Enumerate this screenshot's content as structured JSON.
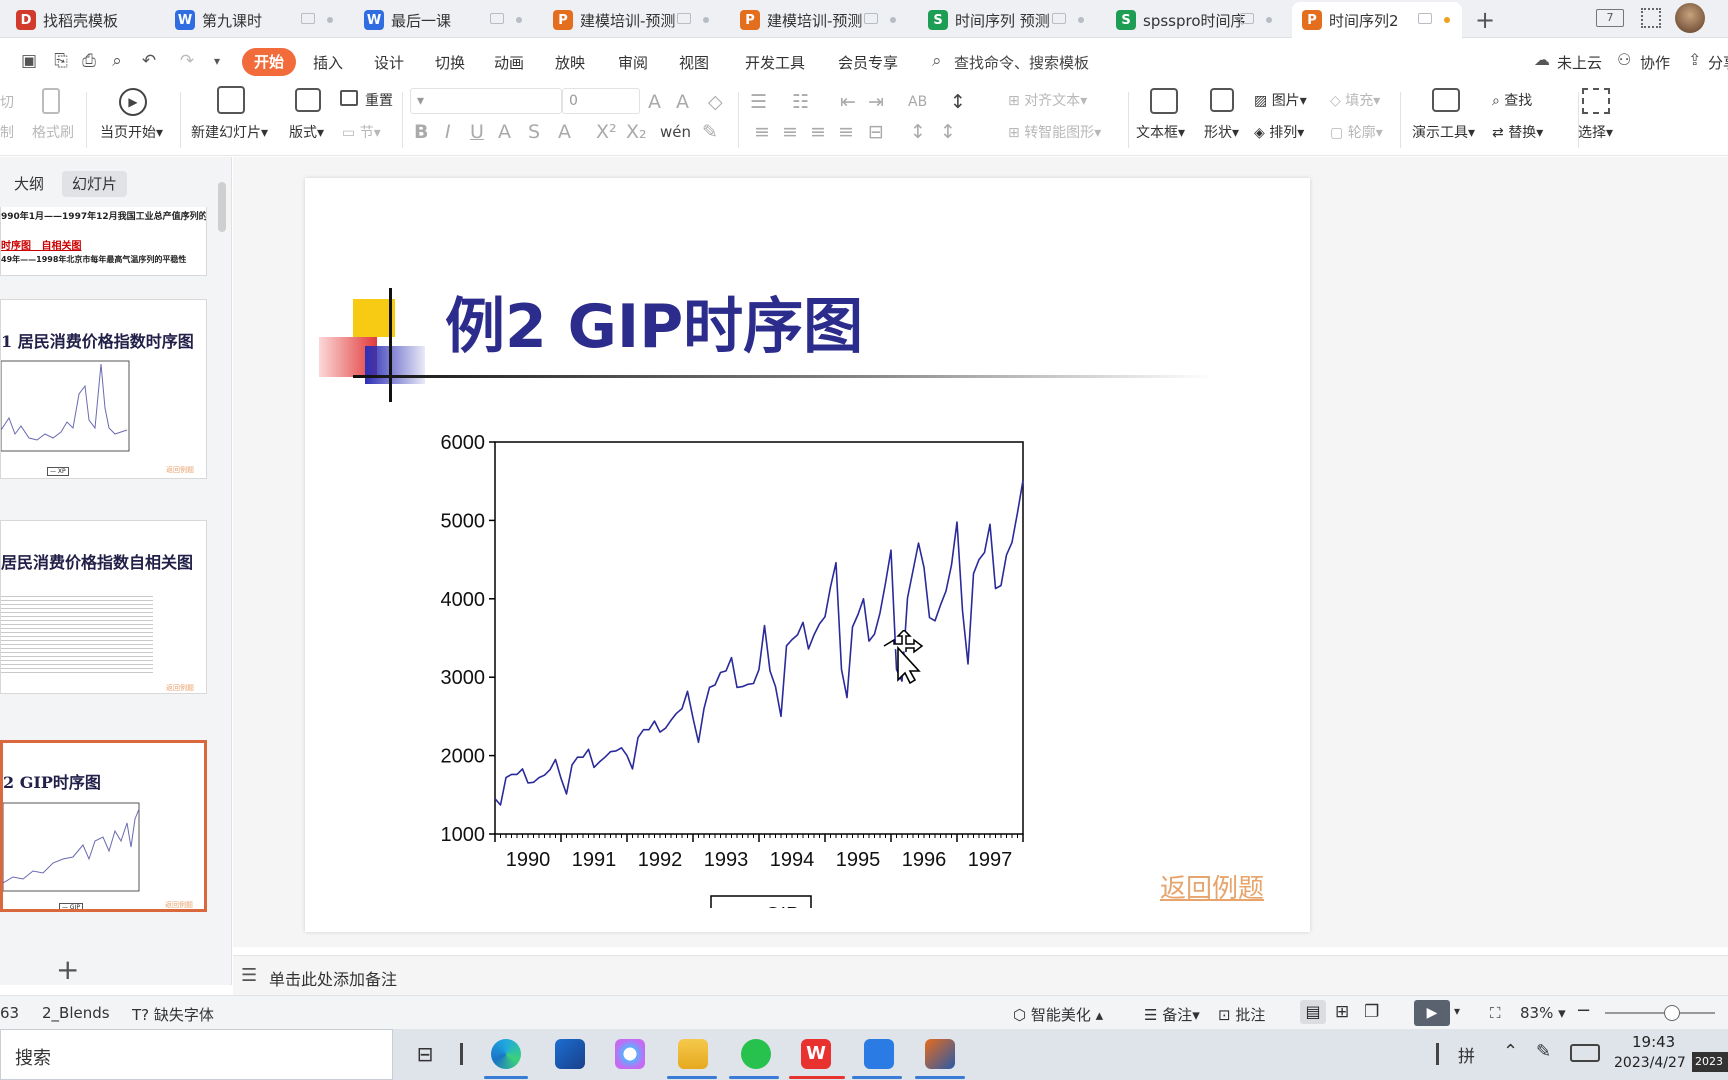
{
  "tabs": [
    {
      "label": "找稻壳模板",
      "icon": "docer-icon",
      "color": "#d23b2c",
      "glyph": "D",
      "active": false
    },
    {
      "label": "第九课时",
      "icon": "writer-doc-icon",
      "color": "#2f6de1",
      "glyph": "W",
      "active": false
    },
    {
      "label": "最后一课",
      "icon": "writer-doc-icon",
      "color": "#2f6de1",
      "glyph": "W",
      "active": false
    },
    {
      "label": "建模培训-预测",
      "icon": "presentation-icon",
      "color": "#e36f1e",
      "glyph": "P",
      "active": false
    },
    {
      "label": "建模培训-预测",
      "icon": "presentation-icon",
      "color": "#e36f1e",
      "glyph": "P",
      "active": false
    },
    {
      "label": "时间序列 预测",
      "icon": "spreadsheet-icon",
      "color": "#1e9e55",
      "glyph": "S",
      "active": false
    },
    {
      "label": "spsspro时间序",
      "icon": "spreadsheet-icon",
      "color": "#1e9e55",
      "glyph": "S",
      "active": false
    },
    {
      "label": "时间序列2",
      "icon": "presentation-icon",
      "color": "#e36f1e",
      "glyph": "P",
      "active": true
    }
  ],
  "menu": {
    "start": "开始",
    "items": [
      "插入",
      "设计",
      "切换",
      "动画",
      "放映",
      "审阅",
      "视图",
      "开发工具",
      "会员专享"
    ],
    "search": "查找命令、搜索模板",
    "cloud": "未上云",
    "collab": "协作",
    "share": "分享"
  },
  "ribbon": {
    "cut": "剪切",
    "copy": "复制",
    "format_painter": "格式刷",
    "play_from_current": "当页开始",
    "new_slide": "新建幻灯片",
    "layout": "版式",
    "reset": "重置",
    "section": "节",
    "font_size": "0",
    "align_text": "对齐文本",
    "smart_art": "转智能图形",
    "text_box": "文本框",
    "shapes": "形状",
    "picture": "图片",
    "arrange": "排列",
    "fill": "填充",
    "outline": "轮廓",
    "present_tools": "演示工具",
    "find": "查找",
    "replace": "替换",
    "select": "选择"
  },
  "left_panel": {
    "tab_outline": "大纲",
    "tab_slides": "幻灯片",
    "thumb1_lines": [
      "990年1月——1997年12月我国工业总产值序列的平",
      "时序图   自相关图",
      "49年——1998年北京市每年最高气温序列的平稳性"
    ],
    "thumb2_title": "1 居民消费价格指数时序图",
    "thumb2_legend": "XP",
    "thumb2_link": "返回例题",
    "thumb3_title": "居民消费价格指数自相关图",
    "thumb3_link": "返回例题",
    "thumb4_title": "2 GIP时序图",
    "thumb4_legend": "GIP",
    "thumb4_link": "返回例题"
  },
  "slide": {
    "title": "例2 GIP时序图",
    "back_link": "返回例题"
  },
  "chart_data": {
    "type": "line",
    "title": "",
    "xlabel": "",
    "ylabel": "",
    "xlim": [
      1990,
      1998
    ],
    "ylim": [
      1000,
      6000
    ],
    "yticks": [
      1000,
      2000,
      3000,
      4000,
      5000,
      6000
    ],
    "xtick_labels": [
      "1990",
      "1991",
      "1992",
      "1993",
      "1994",
      "1995",
      "1996",
      "1997"
    ],
    "legend": "bottom",
    "series": [
      {
        "name": "GIP",
        "color": "#2a2a9a",
        "x_start": 1990,
        "x_step_months": 1,
        "values": [
          1450,
          1370,
          1720,
          1760,
          1760,
          1830,
          1650,
          1660,
          1720,
          1750,
          1820,
          1950,
          1710,
          1510,
          1880,
          1980,
          1980,
          2080,
          1850,
          1920,
          1980,
          2050,
          2060,
          2100,
          2000,
          1830,
          2230,
          2330,
          2330,
          2440,
          2300,
          2350,
          2450,
          2540,
          2600,
          2820,
          2480,
          2170,
          2600,
          2870,
          2900,
          3060,
          3080,
          3250,
          2870,
          2880,
          2910,
          2920,
          3100,
          3660,
          3080,
          2880,
          2500,
          3400,
          3480,
          3540,
          3700,
          3360,
          3540,
          3680,
          3770,
          4150,
          4460,
          3100,
          2740,
          3640,
          3800,
          4000,
          3460,
          3550,
          3820,
          4200,
          4620,
          3100,
          2950,
          4010,
          4360,
          4710,
          4400,
          3760,
          3720,
          3920,
          4100,
          4430,
          4980,
          3850,
          3170,
          4320,
          4500,
          4590,
          4950,
          4130,
          4170,
          4560,
          4720,
          5100,
          5510
        ]
      }
    ]
  },
  "notes": {
    "placeholder": "单击此处添加备注"
  },
  "status": {
    "page": "63",
    "theme": "2_Blends",
    "missing_font": "缺失字体",
    "smart_beautify": "智能美化",
    "notes": "备注",
    "comments": "批注",
    "zoom": "83%"
  },
  "taskbar": {
    "search": "搜索",
    "ime": "拼",
    "time": "19:43",
    "date": "2023/4/27",
    "corner_badge": "2023"
  }
}
